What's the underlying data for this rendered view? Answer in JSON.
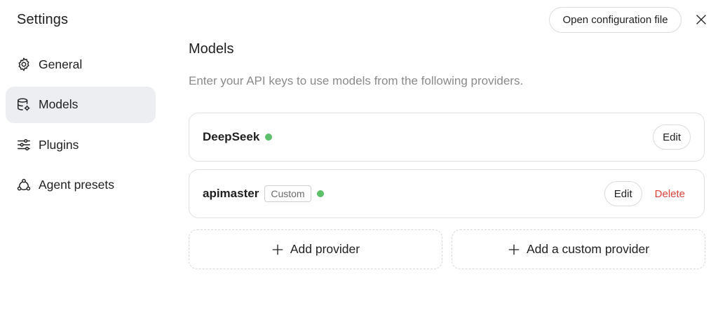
{
  "sidebar": {
    "title": "Settings",
    "items": [
      {
        "label": "General",
        "icon": "gear-icon"
      },
      {
        "label": "Models",
        "icon": "database-icon",
        "active": true
      },
      {
        "label": "Plugins",
        "icon": "sliders-icon"
      },
      {
        "label": "Agent presets",
        "icon": "agent-presets-icon"
      }
    ]
  },
  "header": {
    "open_config_label": "Open configuration file",
    "close_icon": "close-icon"
  },
  "main": {
    "title": "Models",
    "description": "Enter your API keys to use models from the following providers.",
    "providers": [
      {
        "name": "DeepSeek",
        "status": "active",
        "edit_label": "Edit"
      },
      {
        "name": "apimaster",
        "badge": "Custom",
        "status": "active",
        "edit_label": "Edit",
        "delete_label": "Delete"
      }
    ],
    "add_provider_label": "Add provider",
    "add_custom_provider_label": "Add a custom provider"
  },
  "colors": {
    "status_green": "#5cbf6a",
    "delete_red": "#d9423b",
    "active_nav_bg": "#eceef2"
  }
}
